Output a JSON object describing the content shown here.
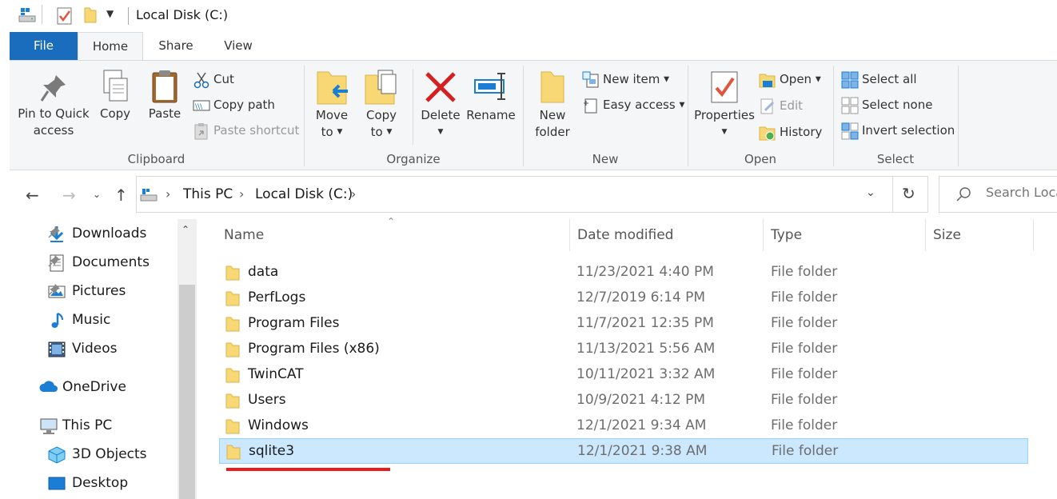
{
  "window": {
    "title": "Local Disk (C:)"
  },
  "quick_access": {
    "icons": [
      "drive-icon",
      "properties-icon",
      "folder-icon",
      "customize-dropdown-icon"
    ]
  },
  "tabs": [
    {
      "label": "File"
    },
    {
      "label": "Home"
    },
    {
      "label": "Share"
    },
    {
      "label": "View"
    }
  ],
  "ribbon": {
    "clipboard": {
      "group_label": "Clipboard",
      "pin_line1": "Pin to Quick",
      "pin_line2": "access",
      "copy": "Copy",
      "paste": "Paste",
      "cut": "Cut",
      "copy_path": "Copy path",
      "paste_shortcut": "Paste shortcut"
    },
    "organize": {
      "group_label": "Organize",
      "move_line1": "Move",
      "move_line2": "to",
      "copy_line1": "Copy",
      "copy_line2": "to",
      "delete": "Delete",
      "rename": "Rename"
    },
    "new": {
      "group_label": "New",
      "new_folder_line1": "New",
      "new_folder_line2": "folder",
      "new_item": "New item",
      "easy_access": "Easy access"
    },
    "open": {
      "group_label": "Open",
      "properties": "Properties",
      "open": "Open",
      "edit": "Edit",
      "history": "History"
    },
    "select": {
      "group_label": "Select",
      "select_all": "Select all",
      "select_none": "Select none",
      "invert_selection": "Invert selection"
    }
  },
  "address": {
    "breadcrumb": [
      "This PC",
      "Local Disk (C:)"
    ],
    "search_placeholder": "Search Local Disk (C:)"
  },
  "nav_pane": {
    "quick_items": [
      {
        "label": "Downloads",
        "icon": "download-arrow-icon",
        "pinned": true
      },
      {
        "label": "Documents",
        "icon": "documents-icon",
        "pinned": true
      },
      {
        "label": "Pictures",
        "icon": "pictures-icon",
        "pinned": true
      },
      {
        "label": "Music",
        "icon": "music-note-icon",
        "pinned": false
      },
      {
        "label": "Videos",
        "icon": "videos-icon",
        "pinned": false
      }
    ],
    "onedrive": "OneDrive",
    "this_pc": "This PC",
    "pc_items": [
      {
        "label": "3D Objects",
        "icon": "cube-icon"
      },
      {
        "label": "Desktop",
        "icon": "desktop-icon"
      }
    ]
  },
  "file_list": {
    "columns": [
      "Name",
      "Date modified",
      "Type",
      "Size"
    ],
    "rows": [
      {
        "name": "data",
        "date": "11/23/2021 4:40 PM",
        "type": "File folder",
        "selected": false
      },
      {
        "name": "PerfLogs",
        "date": "12/7/2019 6:14 PM",
        "type": "File folder",
        "selected": false
      },
      {
        "name": "Program Files",
        "date": "11/7/2021 12:35 PM",
        "type": "File folder",
        "selected": false
      },
      {
        "name": "Program Files (x86)",
        "date": "11/13/2021 5:56 AM",
        "type": "File folder",
        "selected": false
      },
      {
        "name": "TwinCAT",
        "date": "10/11/2021 3:32 AM",
        "type": "File folder",
        "selected": false
      },
      {
        "name": "Users",
        "date": "10/9/2021 4:12 PM",
        "type": "File folder",
        "selected": false
      },
      {
        "name": "Windows",
        "date": "12/1/2021 9:34 AM",
        "type": "File folder",
        "selected": false
      },
      {
        "name": "sqlite3",
        "date": "12/1/2021 9:38 AM",
        "type": "File folder",
        "selected": true
      }
    ]
  },
  "colors": {
    "file_tab": "#1a6dbd",
    "selection_bg": "#cce8ff",
    "selection_border": "#99d1ff",
    "folder": "#f8d775",
    "annotation_underline": "#e81e1e"
  }
}
